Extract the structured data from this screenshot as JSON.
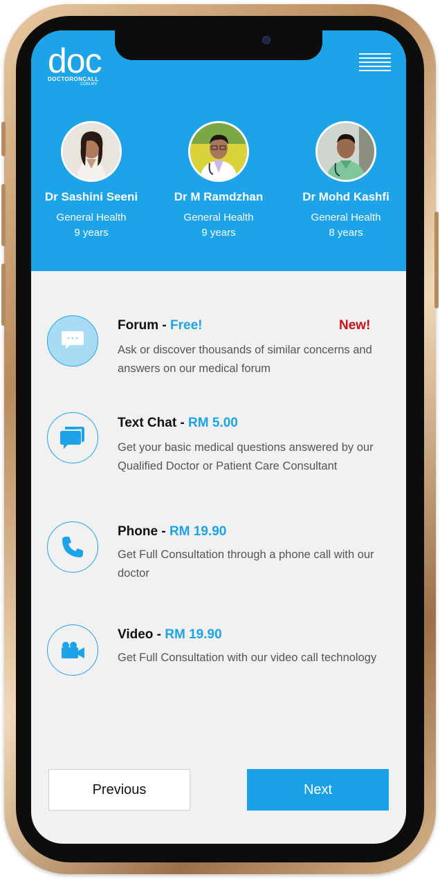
{
  "logo": {
    "word": "doc",
    "brand": "DOCTORONCALL",
    "domain": "COM.MY"
  },
  "colors": {
    "accent": "#1da3e7",
    "new_badge": "#c8121a",
    "background": "#f1f1f1"
  },
  "doctors": [
    {
      "name": "Dr Sashini Seeni",
      "specialty": "General Health",
      "experience": "9 years"
    },
    {
      "name": "Dr M Ramdzhan",
      "specialty": "General Health",
      "experience": "9 years"
    },
    {
      "name": "Dr Mohd Kashfi",
      "specialty": "General Health",
      "experience": "8 years"
    }
  ],
  "options": [
    {
      "title": "Forum - ",
      "price": "Free!",
      "badge": "New!",
      "icon": "forum-chat-bubble-icon",
      "description": "Ask or discover thousands of similar concerns and answers on our medical forum"
    },
    {
      "title": "Text Chat - ",
      "price": "RM 5.00",
      "icon": "text-chat-icon",
      "description": "Get your basic medical questions answered by our Qualified Doctor or Patient Care Consultant"
    },
    {
      "title": "Phone - ",
      "price": "RM 19.90",
      "icon": "phone-icon",
      "description": "Get Full Consultation through a phone call with our doctor"
    },
    {
      "title": "Video - ",
      "price": "RM 19.90",
      "icon": "video-camera-icon",
      "description": "Get Full Consultation with our video call technology"
    }
  ],
  "buttons": {
    "previous": "Previous",
    "next": "Next"
  }
}
